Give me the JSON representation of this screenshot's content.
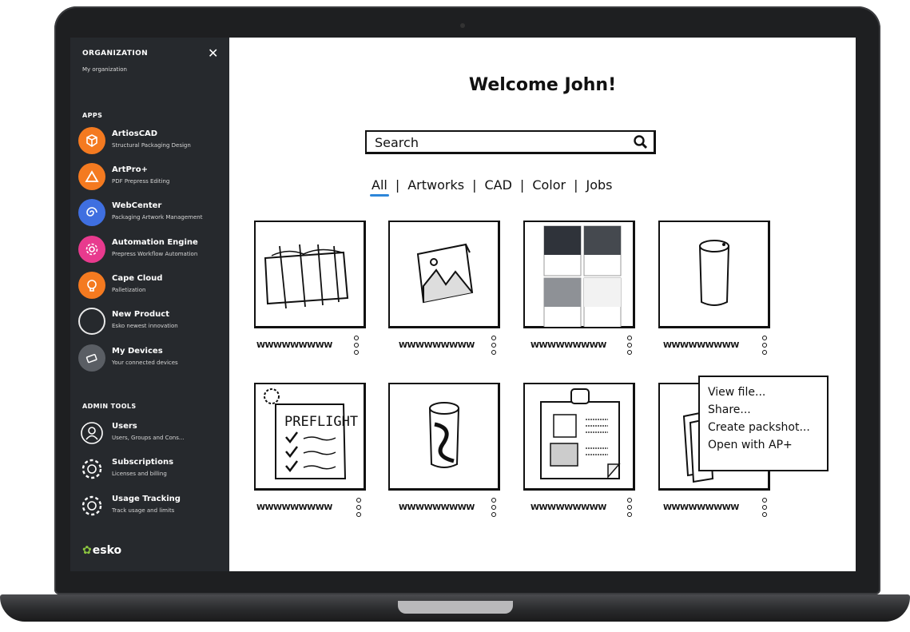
{
  "sidebar": {
    "org_title": "ORGANIZATION",
    "org_name": "My organization",
    "apps_title": "APPS",
    "apps": [
      {
        "name": "ArtiosCAD",
        "desc": "Structural Packaging Design",
        "color": "#f47a20",
        "icon": "cube-icon"
      },
      {
        "name": "ArtPro+",
        "desc": "PDF Prepress Editing",
        "color": "#f47a20",
        "icon": "triangle-icon"
      },
      {
        "name": "WebCenter",
        "desc": "Packaging Artwork Management",
        "color": "#3f6fe0",
        "icon": "spiral-icon"
      },
      {
        "name": "Automation Engine",
        "desc": "Prepress Workflow Automation",
        "color": "#e83a8e",
        "icon": "gear-icon"
      },
      {
        "name": "Cape Cloud",
        "desc": "Palletization",
        "color": "#f47a20",
        "icon": "bulb-icon"
      },
      {
        "name": "New Product",
        "desc": "Esko newest innovation",
        "color": "transparent",
        "icon": "circle-icon"
      },
      {
        "name": "My Devices",
        "desc": "Your connected devices",
        "color": "#5a5e64",
        "icon": "devices-icon"
      }
    ],
    "admin_title": "ADMIN TOOLS",
    "admin": [
      {
        "name": "Users",
        "desc": "Users, Groups and Cons...",
        "icon": "user-icon"
      },
      {
        "name": "Subscriptions",
        "desc": "Licenses and billing",
        "icon": "cog-icon"
      },
      {
        "name": "Usage Tracking",
        "desc": "Track usage and limits",
        "icon": "cog-icon"
      }
    ],
    "logo": "esko"
  },
  "main": {
    "welcome": "Welcome John!",
    "search_placeholder": "Search",
    "filters": [
      "All",
      "Artworks",
      "CAD",
      "Color",
      "Jobs"
    ],
    "card_caption": "WWWWWWWWW",
    "popup_items": [
      "View file...",
      "Share...",
      "Create packshot...",
      "Open with AP+"
    ]
  },
  "colors": {
    "accent": "#2d86d9",
    "sidebar": "#26292d",
    "esko_green": "#8cc63f"
  }
}
